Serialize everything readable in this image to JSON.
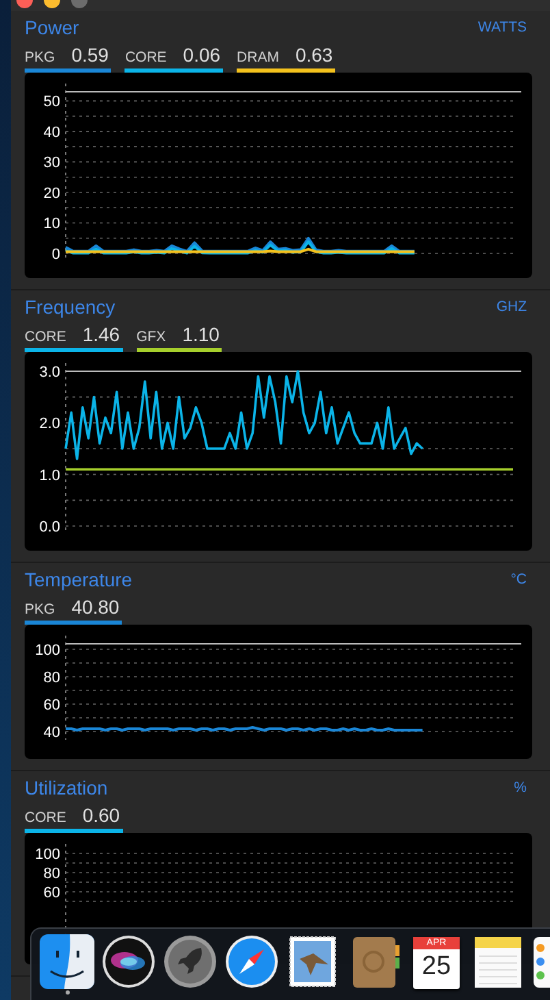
{
  "sections": [
    {
      "title": "Power",
      "unit": "WATTS",
      "legend": [
        {
          "label": "PKG",
          "value": "0.59",
          "color": "#1a86d6"
        },
        {
          "label": "CORE",
          "value": "0.06",
          "color": "#0bb4e8"
        },
        {
          "label": "DRAM",
          "value": "0.63",
          "color": "#f4c21d"
        }
      ],
      "chart_data": {
        "type": "line",
        "grid": true,
        "ylim": [
          0,
          53
        ],
        "yticks": [
          0,
          10,
          20,
          30,
          40,
          50
        ],
        "categories": [
          null,
          null,
          null,
          null,
          null,
          null,
          null,
          null,
          null,
          null,
          null,
          null,
          null,
          null,
          null,
          null,
          null,
          null,
          null,
          null,
          null,
          null,
          null,
          null,
          null,
          null,
          null,
          null,
          null,
          null,
          null,
          null,
          null,
          null,
          null,
          null,
          null,
          null,
          null,
          null,
          null,
          null,
          null,
          null,
          null,
          null,
          null,
          null,
          null,
          null,
          null,
          null,
          null,
          null,
          null,
          null,
          null,
          null,
          null,
          null
        ],
        "series": [
          {
            "color": "#1a86d6",
            "values": [
              2.0,
              0.7,
              0.7,
              0.7,
              2.5,
              0.7,
              0.7,
              0.7,
              0.7,
              1.2,
              0.7,
              0.7,
              1.0,
              0.7,
              2.5,
              1.5,
              0.7,
              3.5,
              0.8,
              0.7,
              0.7,
              0.7,
              0.7,
              0.7,
              0.7,
              1.8,
              1.0,
              3.8,
              1.4,
              1.6,
              1.0,
              1.2,
              5.0,
              1.2,
              0.7,
              0.7,
              1.0,
              0.7,
              0.7,
              0.7,
              0.7,
              0.7,
              0.7,
              2.5,
              0.7,
              0.7,
              0.7,
              null,
              null,
              null,
              null,
              null,
              null,
              null,
              null,
              null,
              null,
              null,
              null,
              null
            ]
          },
          {
            "color": "#0bb4e8",
            "values": [
              1.0,
              0.1,
              0.1,
              0.1,
              1.5,
              0.1,
              0.1,
              0.1,
              0.1,
              0.5,
              0.1,
              0.1,
              0.3,
              0.1,
              1.6,
              0.8,
              0.1,
              2.4,
              0.2,
              0.1,
              0.1,
              0.1,
              0.1,
              0.1,
              0.1,
              1.0,
              0.4,
              2.8,
              0.8,
              1.0,
              0.4,
              0.6,
              3.8,
              0.6,
              0.1,
              0.1,
              0.3,
              0.1,
              0.1,
              0.1,
              0.1,
              0.1,
              0.1,
              1.6,
              0.1,
              0.1,
              0.1,
              null,
              null,
              null,
              null,
              null,
              null,
              null,
              null,
              null,
              null,
              null,
              null,
              null
            ]
          },
          {
            "color": "#f4c21d",
            "values": [
              0.6,
              0.6,
              0.6,
              0.6,
              0.6,
              0.6,
              0.6,
              0.6,
              0.6,
              0.6,
              0.6,
              0.6,
              0.6,
              0.6,
              0.6,
              0.6,
              0.6,
              0.6,
              0.6,
              0.6,
              0.6,
              0.6,
              0.6,
              0.6,
              0.6,
              0.6,
              0.6,
              0.8,
              0.6,
              0.6,
              0.6,
              0.6,
              1.4,
              0.6,
              0.6,
              0.6,
              0.6,
              0.6,
              0.6,
              0.6,
              0.6,
              0.6,
              0.6,
              0.6,
              0.6,
              0.6,
              0.6,
              null,
              null,
              null,
              null,
              null,
              null,
              null,
              null,
              null,
              null,
              null,
              null,
              null
            ]
          }
        ]
      }
    },
    {
      "title": "Frequency",
      "unit": "GHZ",
      "legend": [
        {
          "label": "CORE",
          "value": "1.46",
          "color": "#0bb4e8"
        },
        {
          "label": "GFX",
          "value": "1.10",
          "color": "#a6cf2c"
        }
      ],
      "chart_data": {
        "type": "line",
        "grid": true,
        "ylim": [
          0,
          3
        ],
        "yticks": [
          {
            "value": 0,
            "label": "0.0"
          },
          {
            "value": 1,
            "label": "1.0"
          },
          {
            "value": 2,
            "label": "2.0"
          },
          {
            "value": 3,
            "label": "3.0"
          }
        ],
        "categories": [
          null,
          null,
          null,
          null,
          null,
          null,
          null,
          null,
          null,
          null,
          null,
          null,
          null,
          null,
          null,
          null,
          null,
          null,
          null,
          null,
          null,
          null,
          null,
          null,
          null,
          null,
          null,
          null,
          null,
          null,
          null,
          null,
          null,
          null,
          null,
          null,
          null,
          null,
          null,
          null,
          null,
          null,
          null,
          null,
          null,
          null,
          null,
          null,
          null,
          null,
          null,
          null,
          null,
          null,
          null,
          null,
          null,
          null,
          null,
          null,
          null,
          null,
          null,
          null,
          null,
          null,
          null,
          null,
          null,
          null,
          null,
          null,
          null,
          null,
          null,
          null,
          null,
          null,
          null,
          null
        ],
        "series": [
          {
            "color": "#0bb4e8",
            "values": [
              1.5,
              2.2,
              1.3,
              2.3,
              1.7,
              2.5,
              1.6,
              2.1,
              1.8,
              2.6,
              1.5,
              2.2,
              1.5,
              1.9,
              2.8,
              1.7,
              2.6,
              1.5,
              2.0,
              1.5,
              2.5,
              1.7,
              1.9,
              2.3,
              2.0,
              1.5,
              1.5,
              1.5,
              1.5,
              1.8,
              1.5,
              2.2,
              1.5,
              1.8,
              2.9,
              2.1,
              2.9,
              2.4,
              1.6,
              2.9,
              2.4,
              3.0,
              2.2,
              1.8,
              2.0,
              2.6,
              1.8,
              2.3,
              1.6,
              1.9,
              2.2,
              1.8,
              1.6,
              1.6,
              1.6,
              2.0,
              1.5,
              2.3,
              1.5,
              1.7,
              1.9,
              1.4,
              1.6,
              1.5,
              null,
              null,
              null,
              null,
              null,
              null,
              null,
              null,
              null,
              null,
              null,
              null,
              null,
              null,
              null,
              null
            ]
          },
          {
            "color": "#a6cf2c",
            "values": [
              1.1,
              1.1,
              1.1,
              1.1,
              1.1,
              1.1,
              1.1,
              1.1,
              1.1,
              1.1,
              1.1,
              1.1,
              1.1,
              1.1,
              1.1,
              1.1,
              1.1,
              1.1,
              1.1,
              1.1,
              1.1,
              1.1,
              1.1,
              1.1,
              1.1,
              1.1,
              1.1,
              1.1,
              1.1,
              1.1,
              1.1,
              1.1,
              1.1,
              1.1,
              1.1,
              1.1,
              1.1,
              1.1,
              1.1,
              1.1,
              1.1,
              1.1,
              1.1,
              1.1,
              1.1,
              1.1,
              1.1,
              1.1,
              1.1,
              1.1,
              1.1,
              1.1,
              1.1,
              1.1,
              1.1,
              1.1,
              1.1,
              1.1,
              1.1,
              1.1,
              1.1,
              1.1,
              1.1,
              1.1,
              1.1,
              1.1,
              1.1,
              1.1,
              1.1,
              1.1,
              1.1,
              1.1,
              1.1,
              1.1,
              1.1,
              1.1,
              1.1,
              1.1,
              1.1,
              1.1
            ]
          }
        ]
      }
    },
    {
      "title": "Temperature",
      "unit": "°C",
      "legend": [
        {
          "label": "PKG",
          "value": "40.80",
          "color": "#1a86d6"
        }
      ],
      "chart_data": {
        "type": "line",
        "grid": true,
        "ylim": [
          38,
          104
        ],
        "yticks": [
          40,
          60,
          80,
          100
        ],
        "categories": [
          null,
          null,
          null,
          null,
          null,
          null,
          null,
          null,
          null,
          null,
          null,
          null,
          null,
          null,
          null,
          null,
          null,
          null,
          null,
          null,
          null,
          null,
          null,
          null,
          null,
          null,
          null,
          null,
          null,
          null,
          null,
          null,
          null,
          null,
          null,
          null,
          null,
          null,
          null,
          null,
          null,
          null,
          null,
          null,
          null,
          null,
          null,
          null,
          null,
          null,
          null,
          null,
          null,
          null,
          null,
          null,
          null,
          null,
          null,
          null,
          null,
          null,
          null,
          null,
          null,
          null,
          null,
          null,
          null,
          null,
          null,
          null,
          null,
          null,
          null,
          null,
          null,
          null,
          null,
          null
        ],
        "series": [
          {
            "color": "#1a86d6",
            "values": [
              42,
              42,
              41,
              42,
              42,
              42,
              42,
              41,
              42,
              42,
              41,
              42,
              42,
              42,
              41,
              42,
              42,
              42,
              42,
              41,
              42,
              42,
              42,
              41,
              42,
              42,
              41,
              42,
              42,
              41,
              42,
              42,
              42,
              43,
              42,
              41,
              42,
              42,
              42,
              41,
              42,
              42,
              41,
              42,
              41,
              42,
              42,
              41,
              41,
              42,
              41,
              42,
              41,
              41,
              42,
              41,
              41,
              42,
              41,
              41,
              41,
              41,
              41,
              41,
              null,
              null,
              null,
              null,
              null,
              null,
              null,
              null,
              null,
              null,
              null,
              null,
              null,
              null,
              null,
              null
            ]
          }
        ]
      }
    },
    {
      "title": "Utilization",
      "unit": "%",
      "legend": [
        {
          "label": "CORE",
          "value": "0.60",
          "color": "#0bb4e8"
        }
      ],
      "axis_labels": [
        "100",
        "80",
        "60"
      ]
    }
  ],
  "dock": {
    "items": [
      {
        "kind": "finder",
        "running": true
      },
      {
        "kind": "siri",
        "running": false
      },
      {
        "kind": "launchpad",
        "running": false
      },
      {
        "kind": "safari",
        "running": false
      },
      {
        "kind": "mail",
        "running": false
      },
      {
        "kind": "contacts",
        "running": false
      },
      {
        "kind": "calendar",
        "month": "APR",
        "day": "25",
        "running": false
      },
      {
        "kind": "notes",
        "running": false
      },
      {
        "kind": "reminders",
        "running": false
      }
    ]
  }
}
